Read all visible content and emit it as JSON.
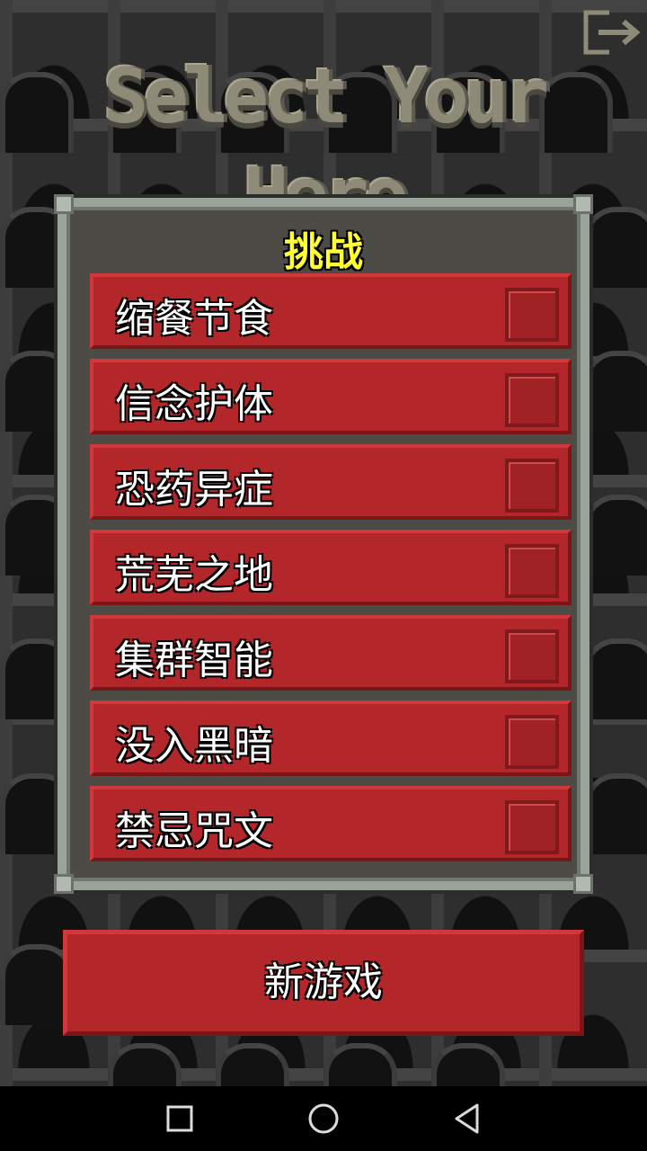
{
  "screen": {
    "title": "Select Your Hero"
  },
  "panel": {
    "title": "挑战",
    "challenges": [
      {
        "label": "缩餐节食",
        "checked": false
      },
      {
        "label": "信念护体",
        "checked": false
      },
      {
        "label": "恐药异症",
        "checked": false
      },
      {
        "label": "荒芜之地",
        "checked": false
      },
      {
        "label": "集群智能",
        "checked": false
      },
      {
        "label": "没入黑暗",
        "checked": false
      },
      {
        "label": "禁忌咒文",
        "checked": false
      }
    ]
  },
  "actions": {
    "new_game_label": "新游戏"
  },
  "icons": {
    "exit": "exit-icon",
    "square": "recent-apps-icon",
    "circle": "home-icon",
    "triangle": "back-icon"
  },
  "colors": {
    "button_red": "#b3272b",
    "title_yellow": "#ffff33",
    "panel_frame": "#9aa39a"
  }
}
